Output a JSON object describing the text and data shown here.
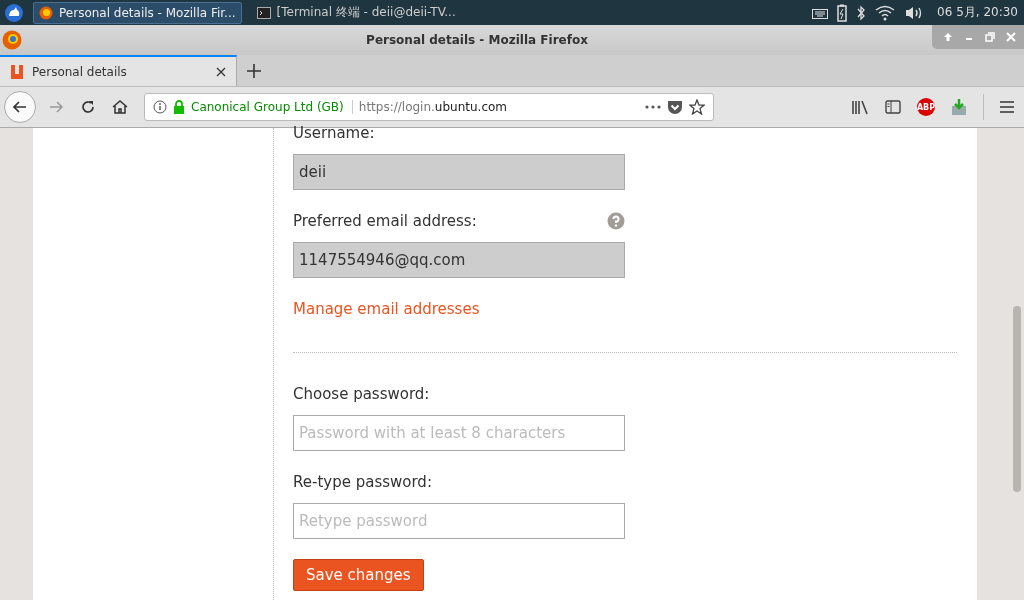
{
  "taskbar": {
    "windows": [
      {
        "title": "Personal details - Mozilla Fir...",
        "selected": true,
        "kind": "browser"
      },
      {
        "title": "[Terminal 终端 - deii@deii-TV...",
        "selected": false,
        "kind": "terminal"
      }
    ],
    "clock": "06 5月, 20:30"
  },
  "window": {
    "title": "Personal details - Mozilla Firefox"
  },
  "tabs": [
    {
      "label": "Personal details",
      "selected": true
    }
  ],
  "address_bar": {
    "identity": "Canonical Group Ltd (GB)",
    "url_prefix": "https://login.",
    "url_domain": "ubuntu.com"
  },
  "toolbar": {
    "adblock_label": "ABP"
  },
  "form": {
    "fields": [
      {
        "label": "Username:",
        "value": "deii",
        "disabled": true,
        "help": false
      },
      {
        "label": "Preferred email address:",
        "value": "1147554946@qq.com",
        "disabled": true,
        "help": true
      }
    ],
    "manage_link": "Manage email addresses",
    "password_fields": [
      {
        "label": "Choose password:",
        "placeholder": "Password with at least 8 characters",
        "disabled": false
      },
      {
        "label": "Re-type password:",
        "placeholder": "Retype password",
        "disabled": false
      }
    ],
    "save_button": "Save changes"
  }
}
